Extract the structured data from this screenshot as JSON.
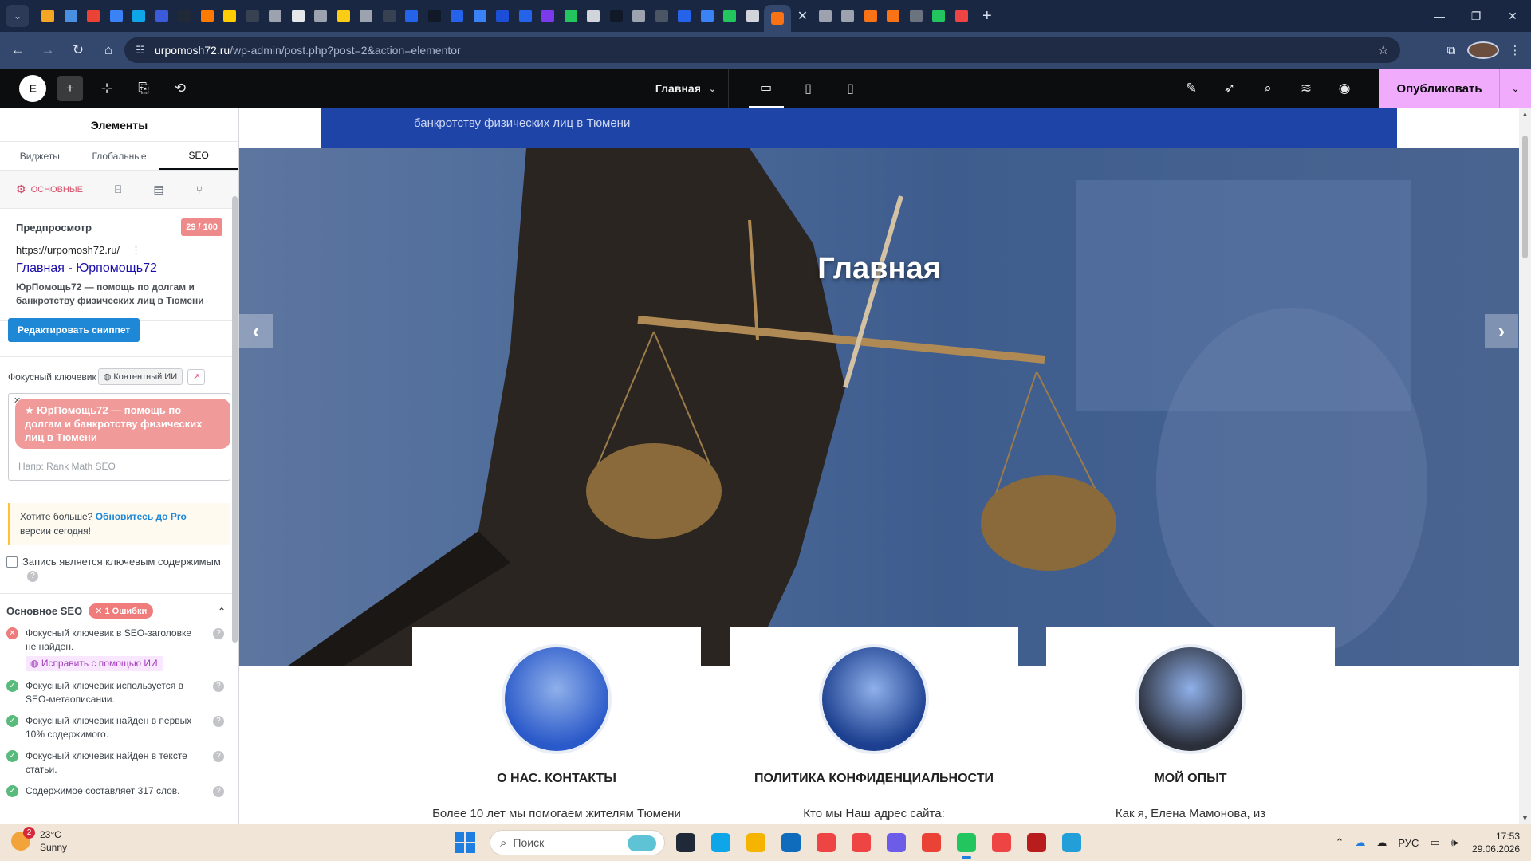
{
  "browser": {
    "url_host": "urpomosh72.ru",
    "url_path": "/wp-admin/post.php?post=2&action=elementor",
    "tab_favicon_colors": [
      "#f5a623",
      "#4a90e2",
      "#ea4335",
      "#3b82f6",
      "#0ea5e9",
      "#3b5bdb",
      "#1f2937",
      "#ff7a00",
      "#ffcc00",
      "#374151",
      "#9ca3af",
      "#e5e7eb",
      "#9ca3af",
      "#facc15",
      "#9ca3af",
      "#374151",
      "#2563eb",
      "#111827",
      "#2563eb",
      "#3b82f6",
      "#1d4ed8",
      "#2563eb",
      "#7c3aed",
      "#22c55e",
      "#d1d5db",
      "#111827",
      "#9ca3af",
      "#4b5563",
      "#2563eb",
      "#3b82f6",
      "#22c55e",
      "#d1d5db",
      "#f97316",
      "#9ca3af",
      "#9ca3af",
      "#f97316",
      "#f97316",
      "#6b7280",
      "#22c55e",
      "#ef4444"
    ]
  },
  "elementor": {
    "page_selector": "Главная",
    "publish_label": "Опубликовать"
  },
  "panel": {
    "title": "Элементы",
    "tabs": [
      "Виджеты",
      "Глобальные",
      "SEO"
    ],
    "seo_tab_label": "Основные",
    "preview_heading": "Предпросмотр",
    "score": "29 / 100",
    "snippet_url": "https://urpomosh72.ru/",
    "snippet_title": "Главная - Юрпомощь72",
    "snippet_desc": "ЮрПомощь72 — помощь по долгам и банкротству физических лиц в Тюмени",
    "edit_snippet": "Редактировать сниппет",
    "focus_label": "Фокусный ключевик",
    "content_ai": "Контентный ИИ",
    "keyword_tag": "ЮрПомощь72 — помощь по долгам и банкротству физических лиц в Тюмени",
    "keyword_placeholder": "Напр: Rank Math SEO",
    "upsell_prefix": "Хотите больше?",
    "upsell_link": "Обновитесь до Pro",
    "upsell_suffix": "версии сегодня!",
    "cornerstone": "Запись является ключевым содержимым",
    "basic_seo": "Основное SEO",
    "errors_badge": "1 Ошибки",
    "checks": [
      {
        "status": "bad",
        "text": "Фокусный ключевик в SEO-заголовке не найден."
      },
      {
        "status": "ok",
        "text": "Фокусный ключевик используется в SEO-метаописании."
      },
      {
        "status": "ok",
        "text": "Фокусный ключевик найден в первых 10% содержимого."
      },
      {
        "status": "ok",
        "text": "Фокусный ключевик найден в тексте статьи."
      },
      {
        "status": "ok",
        "text": "Содержимое составляет 317 слов."
      }
    ],
    "fix_ai": "Исправить с помощью ИИ"
  },
  "canvas": {
    "top_strip_text": "банкротству физических лиц в Тюмени",
    "hero_title": "Главная",
    "cards": [
      {
        "title": "О НАС. КОНТАКТЫ",
        "desc": "Более 10 лет мы помогаем жителям Тюмени",
        "color": "#2a59c9"
      },
      {
        "title": "ПОЛИТИКА КОНФИДЕНЦИАЛЬНОСТИ",
        "desc": "Кто мы Наш адрес сайта:",
        "color": "#1c3f8f"
      },
      {
        "title": "МОЙ ОПЫТ",
        "desc": "Как я, Елена Мамонова, из",
        "color": "#2b2f3a"
      }
    ]
  },
  "taskbar": {
    "temp": "23°C",
    "weather": "Sunny",
    "weather_badge": "2",
    "search_placeholder": "Поиск",
    "lang": "РУС",
    "time": "17:53",
    "date": "29.06.2026",
    "app_colors": [
      "#1f2937",
      "#0ea5e9",
      "#f5b400",
      "#0f6cbd",
      "#ef4444",
      "#ef4444",
      "#6d5ce8",
      "#ea4335",
      "#22c55e",
      "#ef4444",
      "#b91c1c",
      "#229ed9"
    ]
  }
}
